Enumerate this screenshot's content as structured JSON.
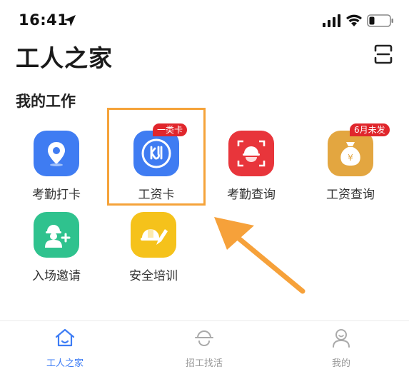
{
  "status_bar": {
    "time": "16:41"
  },
  "header": {
    "title": "工人之家"
  },
  "section": {
    "title": "我的工作"
  },
  "grid": {
    "items": [
      {
        "label": "考勤打卡",
        "icon": "location-pin-icon",
        "color": "#3f7cf2"
      },
      {
        "label": "工资卡",
        "icon": "salary-card-icon",
        "color": "#3f7cf2",
        "badge": "一类卡"
      },
      {
        "label": "考勤查询",
        "icon": "worker-helmet-scan-icon",
        "color": "#e8353b"
      },
      {
        "label": "工资查询",
        "icon": "money-bag-icon",
        "color": "#e3a640",
        "badge": "6月未发"
      },
      {
        "label": "入场邀请",
        "icon": "worker-add-icon",
        "color": "#2fc28e"
      },
      {
        "label": "安全培训",
        "icon": "helmet-pencil-icon",
        "color": "#f5c21b"
      }
    ]
  },
  "tabs": [
    {
      "label": "工人之家",
      "icon": "home-icon",
      "active": true
    },
    {
      "label": "招工找活",
      "icon": "helmet-icon",
      "active": false
    },
    {
      "label": "我的",
      "icon": "person-icon",
      "active": false
    }
  ],
  "colors": {
    "accent": "#3d7cf5",
    "highlight": "#f5a33a",
    "badge": "#e0262c"
  }
}
